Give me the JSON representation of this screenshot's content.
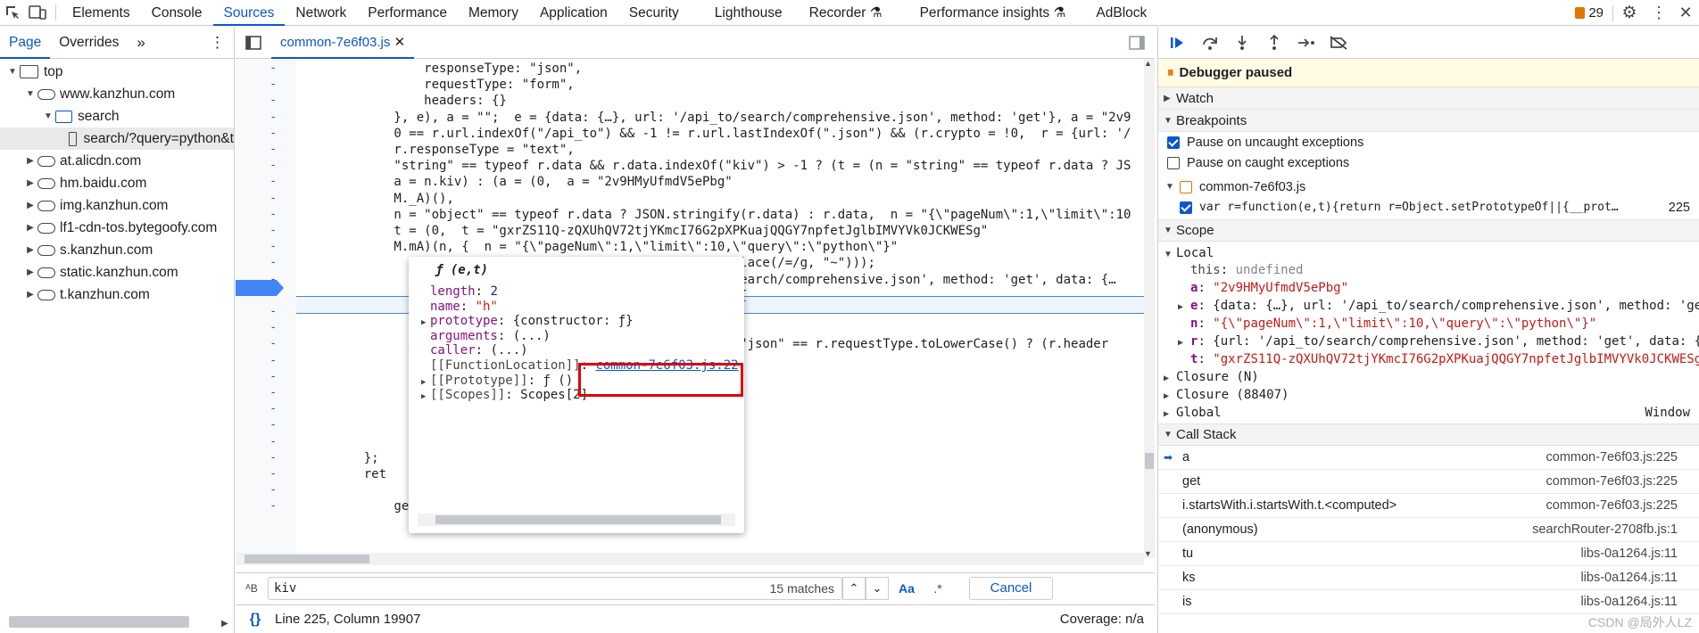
{
  "topbar": {
    "tabs": [
      "Elements",
      "Console",
      "Sources",
      "Network",
      "Performance",
      "Memory",
      "Application",
      "Security",
      "Lighthouse",
      "Recorder",
      "Performance insights",
      "AdBlock"
    ],
    "active_tab": "Sources",
    "issue_count": "29"
  },
  "left": {
    "tabs": [
      "Page",
      "Overrides"
    ],
    "tree": [
      {
        "label": "top",
        "icon": "frame",
        "indent": 0,
        "open": true
      },
      {
        "label": "www.kanzhun.com",
        "icon": "cloud",
        "indent": 1,
        "open": true
      },
      {
        "label": "search",
        "icon": "folder",
        "indent": 2,
        "open": true
      },
      {
        "label": "search/?query=python&t",
        "icon": "file",
        "indent": 3,
        "selected": true
      },
      {
        "label": "at.alicdn.com",
        "icon": "cloud",
        "indent": 1
      },
      {
        "label": "hm.baidu.com",
        "icon": "cloud",
        "indent": 1
      },
      {
        "label": "img.kanzhun.com",
        "icon": "cloud",
        "indent": 1
      },
      {
        "label": "lf1-cdn-tos.bytegoofy.com",
        "icon": "cloud",
        "indent": 1
      },
      {
        "label": "s.kanzhun.com",
        "icon": "cloud",
        "indent": 1
      },
      {
        "label": "static.kanzhun.com",
        "icon": "cloud",
        "indent": 1
      },
      {
        "label": "t.kanzhun.com",
        "icon": "cloud",
        "indent": 1
      }
    ]
  },
  "editor": {
    "file_tab": "common-7e6f03.js",
    "code": [
      "            responseType: \"json\",",
      "            requestType: \"form\",",
      "            headers: {}",
      "        }, e), a = \"\";  e = {data: {…}, url: '/api_to/search/comprehensive.json', method: 'get'}, a = \"2v9",
      "        0 == r.url.indexOf(\"/api_to\") && -1 != r.url.lastIndexOf(\".json\") && (r.crypto = !0,  r = {url: '/",
      "        r.responseType = \"text\",",
      "        \"string\" == typeof r.data && r.data.indexOf(\"kiv\") > -1 ? (t = (n = \"string\" == typeof r.data ? JS",
      "        a = n.kiv) : (a = (0,  a = \"2v9HMyUfmdV5ePbg\"",
      "        M._A)(),",
      "        n = \"object\" == typeof r.data ? JSON.stringify(r.data) : r.data,  n = \"{\\\"pageNum\\\":1,\\\"limit\\\":10",
      "        t = (0,  t = \"gxrZS11Q-zQXUhQV72tjYKmcI76G2pXPKuajQQGY7npfetJglbIMVYVk0JCKWESg\"",
      "        M.mA)(n, {  n = \"{\\\"pageNum\\\":1,\\\"limit\\\":10,\\\"query\\\":\\\"python\\\"}\"",
      "                                                  .replace(/=/g, \"~\")));",
      "                                                 _to/search/comprehensive.json', method: 'get', data: {…",
      "                                                  a ? {",
      "",
      "",
      "                                                 ) && \"json\" == r.requestType.toLowerCase() ? (r.header",
      "",
      "",
      "",
      "",
      "",
      "",
      "    };",
      "    ret",
      "",
      "        get: function(e, t, n) {"
    ],
    "popover": {
      "title": "ƒ (e,t)",
      "rows": [
        {
          "k": "length",
          "v": "2"
        },
        {
          "k": "name",
          "v": "\"h\""
        },
        {
          "k": "prototype",
          "v": "{constructor: ƒ}",
          "expand": true
        },
        {
          "k": "arguments",
          "v": "(...)"
        },
        {
          "k": "caller",
          "v": "(...)"
        },
        {
          "k": "[[FunctionLocation]]",
          "v": "common-7e6f03.js:22",
          "link": true
        },
        {
          "k": "[[Prototype]]",
          "v": "ƒ ()",
          "expand": true
        },
        {
          "k": "[[Scopes]]",
          "v": "Scopes[2]",
          "expand": true
        }
      ]
    },
    "find_query": "kiv",
    "find_matches": "15 matches",
    "find_case": "Aa",
    "find_regex": ".*",
    "find_cancel": "Cancel",
    "status_position": "Line 225, Column 19907",
    "status_coverage": "Coverage: n/a"
  },
  "right": {
    "paused": "Debugger paused",
    "watch": "Watch",
    "breakpoints": "Breakpoints",
    "pause_uncaught": "Pause on uncaught exceptions",
    "pause_caught": "Pause on caught exceptions",
    "bp_file": "common-7e6f03.js",
    "bp_code": "var r=function(e,t){return r=Object.setPrototypeOf||{__prot…",
    "bp_line": "225",
    "scope": "Scope",
    "local": "Local",
    "locals": [
      {
        "k": "this",
        "v": "undefined"
      },
      {
        "k": "a",
        "v": "\"2v9HMyUfmdV5ePbg\""
      },
      {
        "k": "e",
        "v": "{data: {…}, url: '/api_to/search/comprehensive.json', method: 'get",
        "expand": true
      },
      {
        "k": "n",
        "v": "\"{\\\"pageNum\\\":1,\\\"limit\\\":10,\\\"query\\\":\\\"python\\\"}\""
      },
      {
        "k": "r",
        "v": "{url: '/api_to/search/comprehensive.json', method: 'get', data: {…",
        "expand": true
      },
      {
        "k": "t",
        "v": "\"gxrZS11Q-zQXUhQV72tjYKmcI76G2pXPKuajQQGY7npfetJglbIMVYVk0JCKWESg\""
      }
    ],
    "closures": [
      "Closure (N)",
      "Closure (88407)",
      "Global"
    ],
    "global_val": "Window",
    "call_stack": "Call Stack",
    "stack": [
      {
        "fn": "a",
        "loc": "common-7e6f03.js:225",
        "current": true
      },
      {
        "fn": "get",
        "loc": "common-7e6f03.js:225"
      },
      {
        "fn": "i.startsWith.i.startsWith.t.<computed>",
        "loc": "common-7e6f03.js:225"
      },
      {
        "fn": "(anonymous)",
        "loc": "searchRouter-2708fb.js:1"
      },
      {
        "fn": "tu",
        "loc": "libs-0a1264.js:11"
      },
      {
        "fn": "ks",
        "loc": "libs-0a1264.js:11"
      },
      {
        "fn": "is",
        "loc": "libs-0a1264.js:11"
      }
    ],
    "watermark": "CSDN @局外人LZ"
  }
}
